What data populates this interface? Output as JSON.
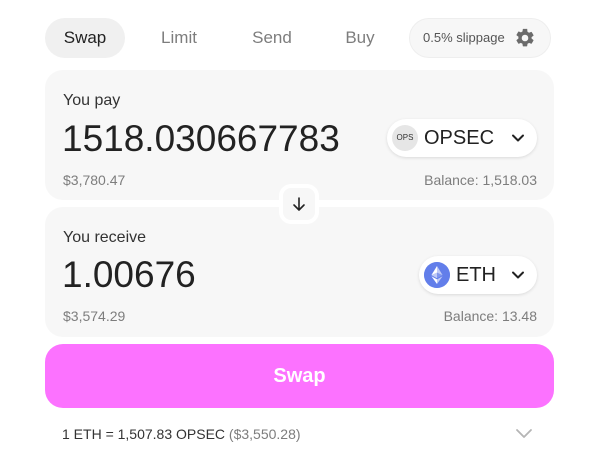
{
  "tabs": [
    {
      "label": "Swap",
      "active": true
    },
    {
      "label": "Limit",
      "active": false
    },
    {
      "label": "Send",
      "active": false
    },
    {
      "label": "Buy",
      "active": false
    }
  ],
  "settings": {
    "slippage_label": "0.5% slippage",
    "icon": "gear-icon"
  },
  "pay": {
    "label": "You pay",
    "amount": "1518.030667783",
    "fiat_value": "$3,780.47",
    "balance": "Balance: 1,518.03",
    "token": {
      "symbol": "OPSEC",
      "icon_text": "OPS",
      "icon": "opsec-token-icon"
    }
  },
  "switch": {
    "icon": "arrow-down-icon"
  },
  "receive": {
    "label": "You receive",
    "amount": "1.00676",
    "fiat_value": "$3,574.29",
    "balance": "Balance: 13.48",
    "token": {
      "symbol": "ETH",
      "icon": "eth-token-icon"
    }
  },
  "swap_button": {
    "label": "Swap",
    "color": "#fc72ff"
  },
  "rate": {
    "text": "1 ETH = 1,507.83 OPSEC",
    "fiat": "($3,550.28)"
  }
}
